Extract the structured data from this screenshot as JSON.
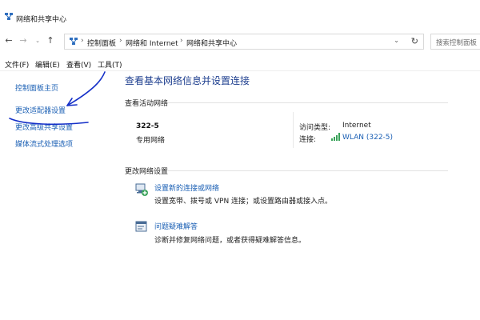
{
  "window": {
    "title": "网络和共享中心"
  },
  "address": {
    "crumbs": [
      "控制面板",
      "网络和 Internet",
      "网络和共享中心"
    ],
    "search_placeholder": "搜索控制面板"
  },
  "menu": [
    "文件(F)",
    "编辑(E)",
    "查看(V)",
    "工具(T)"
  ],
  "sidebar": {
    "items": [
      "控制面板主页",
      "更改适配器设置",
      "更改高级共享设置",
      "媒体流式处理选项"
    ]
  },
  "main": {
    "title": "查看基本网络信息并设置连接",
    "active_label": "查看活动网络",
    "network": {
      "name": "322-5",
      "type": "专用网络",
      "access_key": "访问类型:",
      "access_value": "Internet",
      "conn_key": "连接:",
      "conn_value": "WLAN (322-5)"
    },
    "change_label": "更改网络设置",
    "tasks": [
      {
        "link": "设置新的连接或网络",
        "desc": "设置宽带、拨号或 VPN 连接；或设置路由器或接入点。"
      },
      {
        "link": "问题疑难解答",
        "desc": "诊断并修复网络问题，或者获得疑难解答信息。"
      }
    ]
  },
  "colors": {
    "link": "#1a5fb4",
    "title": "#1e3f8f",
    "annotation": "#1530c8"
  }
}
